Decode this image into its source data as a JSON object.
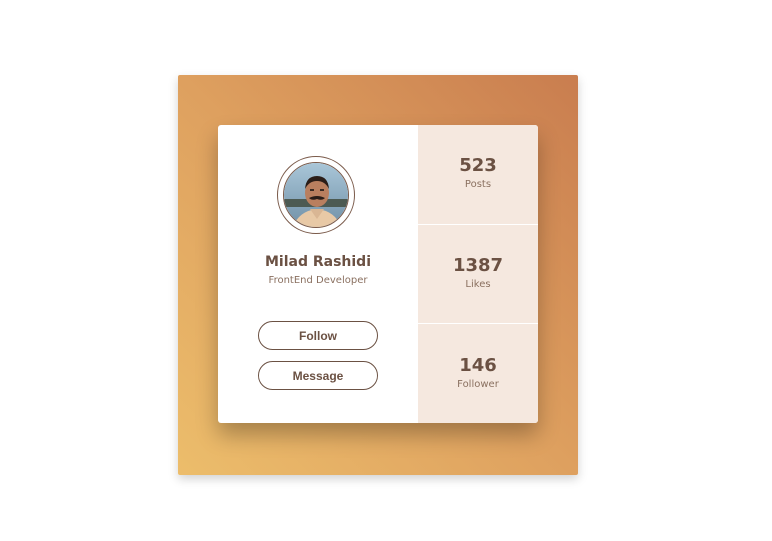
{
  "profile": {
    "name": "Milad Rashidi",
    "role": "FrontEnd Developer",
    "follow_label": "Follow",
    "message_label": "Message"
  },
  "stats": [
    {
      "value": "523",
      "label": "Posts"
    },
    {
      "value": "1387",
      "label": "Likes"
    },
    {
      "value": "146",
      "label": "Follower"
    }
  ],
  "colors": {
    "gradient_start": "#ecbd6b",
    "gradient_end": "#c97d4f",
    "text_brown": "#6b5143",
    "stats_bg": "#f5e8df"
  }
}
